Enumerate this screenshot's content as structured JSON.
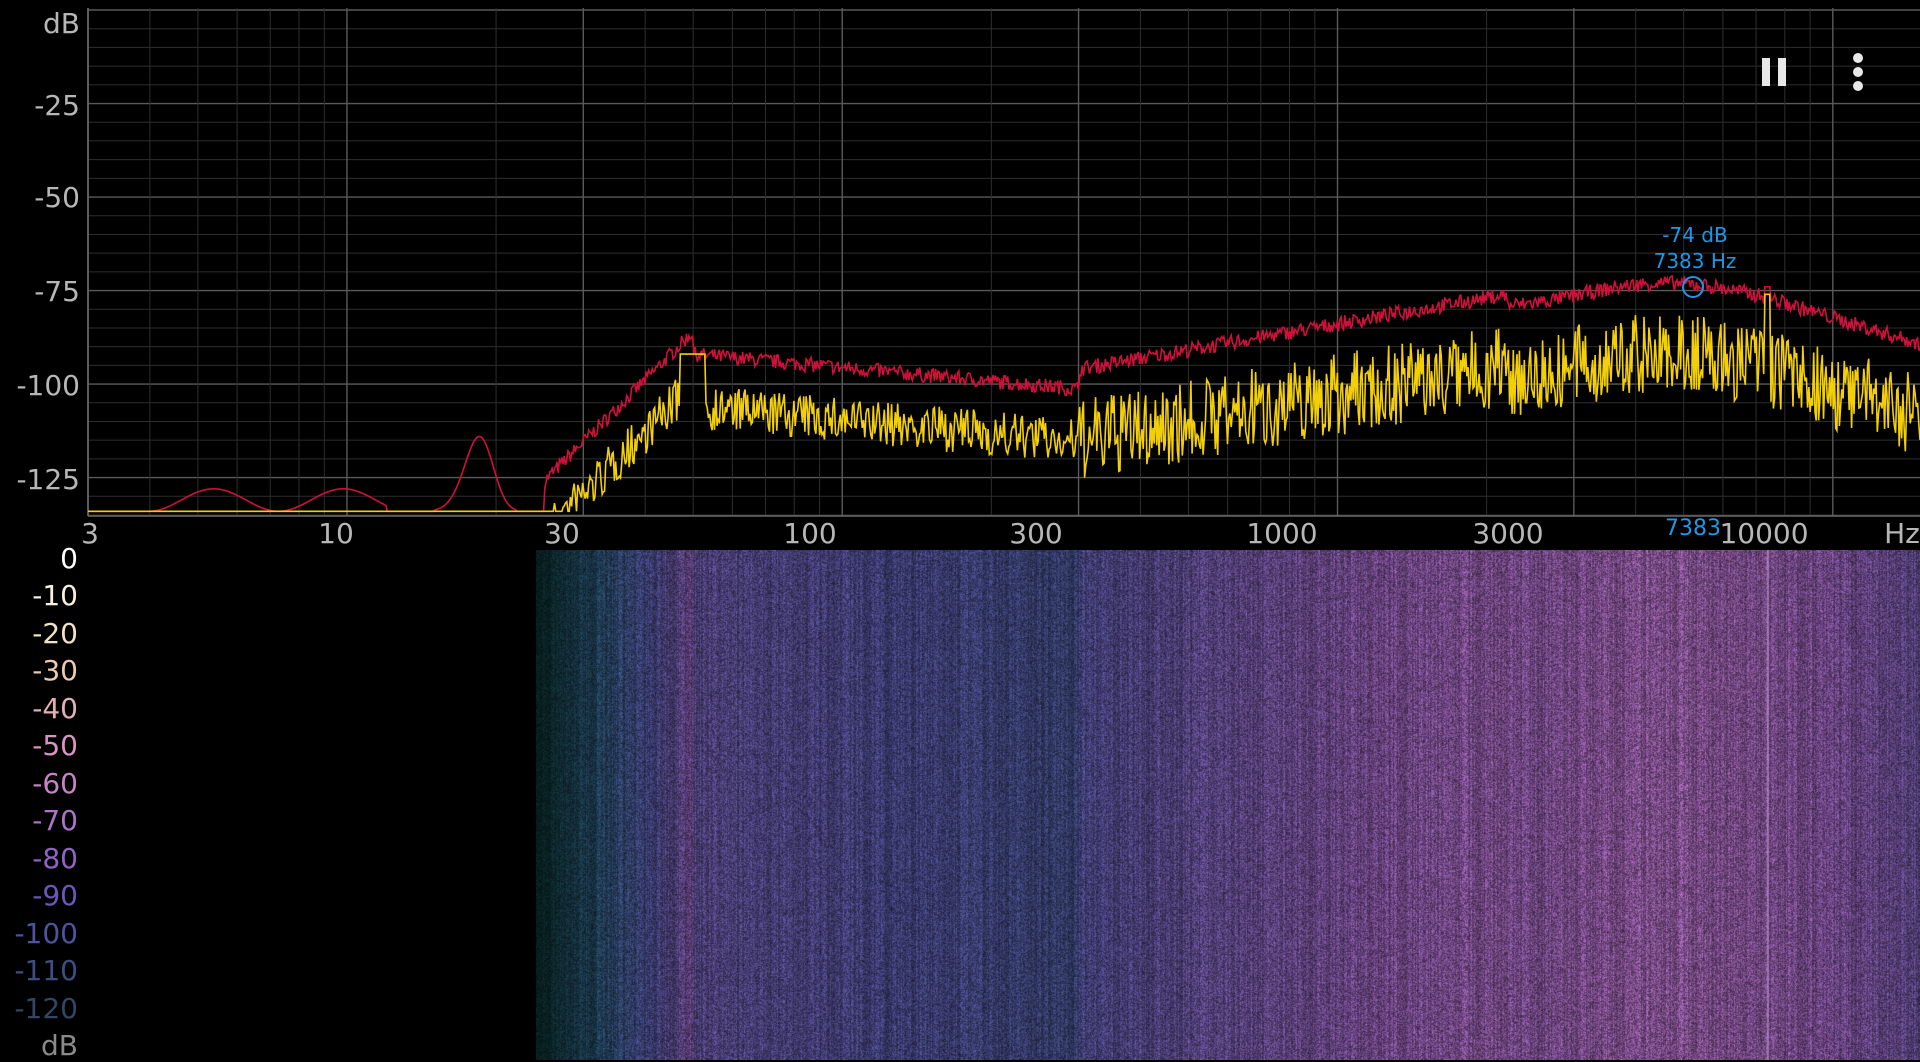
{
  "spectrum": {
    "y_unit": "dB",
    "x_unit": "Hz",
    "y_ticks": [
      "-25",
      "-50",
      "-75",
      "-100",
      "-125"
    ],
    "x_ticks": [
      "3",
      "10",
      "30",
      "100",
      "300",
      "1000",
      "3000",
      "10000"
    ],
    "series_colors": {
      "peak_hold": "#d0103a",
      "current": "#f2cf07"
    },
    "peak": {
      "db_label": "-74 dB",
      "freq_label": "7383 Hz",
      "freq_axis_label": "7383"
    }
  },
  "colorbar": {
    "unit": "dB",
    "ticks": [
      "0",
      "-10",
      "-20",
      "-30",
      "-40",
      "-50",
      "-60",
      "-70",
      "-80",
      "-90",
      "-100",
      "-110",
      "-120"
    ],
    "tick_colors": [
      "#ffffff",
      "#fbf0dc",
      "#f1e3c1",
      "#eccab0",
      "#e3b0b5",
      "#d994c0",
      "#c882c7",
      "#ad73c9",
      "#9063c4",
      "#6c57b6",
      "#4e539f",
      "#3c4e85",
      "#334765"
    ]
  },
  "toolbar": {
    "pause_icon": "pause-icon",
    "menu_icon": "more-vert-icon"
  }
}
